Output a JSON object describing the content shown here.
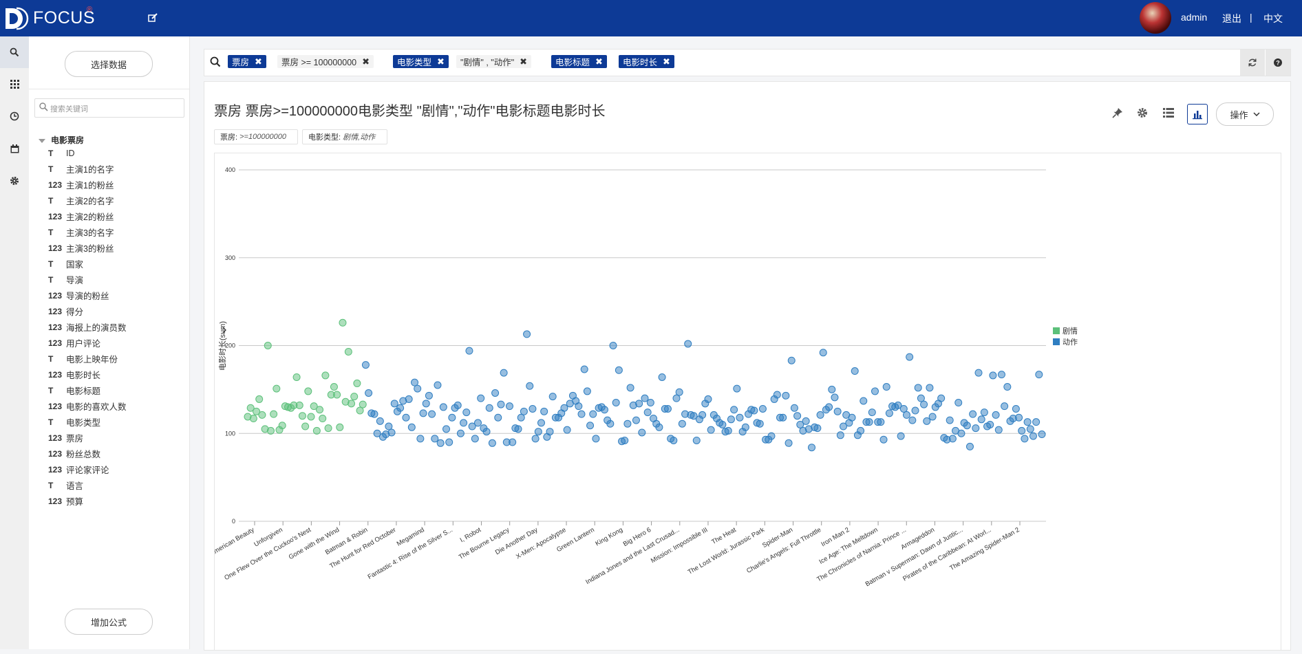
{
  "header": {
    "brand": "FOCUS",
    "brand_mark": "®",
    "user": "admin",
    "logout": "退出",
    "separator": "|",
    "language": "中文"
  },
  "rail": {
    "items": [
      "search-icon",
      "grid-icon",
      "history-icon",
      "calendar-icon",
      "settings-icon"
    ]
  },
  "sidebar": {
    "select_data": "选择数据",
    "search_placeholder": "搜索关键词",
    "root": "电影票房",
    "fields": [
      {
        "type": "T",
        "name": "ID"
      },
      {
        "type": "T",
        "name": "主演1的名字"
      },
      {
        "type": "123",
        "name": "主演1的粉丝"
      },
      {
        "type": "T",
        "name": "主演2的名字"
      },
      {
        "type": "123",
        "name": "主演2的粉丝"
      },
      {
        "type": "T",
        "name": "主演3的名字"
      },
      {
        "type": "123",
        "name": "主演3的粉丝"
      },
      {
        "type": "T",
        "name": "国家"
      },
      {
        "type": "T",
        "name": "导演"
      },
      {
        "type": "123",
        "name": "导演的粉丝"
      },
      {
        "type": "123",
        "name": "得分"
      },
      {
        "type": "123",
        "name": "海报上的演员数"
      },
      {
        "type": "123",
        "name": "用户评论"
      },
      {
        "type": "T",
        "name": "电影上映年份"
      },
      {
        "type": "123",
        "name": "电影时长"
      },
      {
        "type": "T",
        "name": "电影标题"
      },
      {
        "type": "123",
        "name": "电影的喜欢人数"
      },
      {
        "type": "T",
        "name": "电影类型"
      },
      {
        "type": "123",
        "name": "票房"
      },
      {
        "type": "123",
        "name": "粉丝总数"
      },
      {
        "type": "123",
        "name": "评论家评论"
      },
      {
        "type": "T",
        "name": "语言"
      },
      {
        "type": "123",
        "name": "预算"
      }
    ],
    "add_formula": "增加公式"
  },
  "search": {
    "chips": [
      {
        "label": "票房",
        "style": "blue"
      },
      {
        "label": "票房 >= 100000000",
        "style": "plain"
      },
      {
        "label": "电影类型",
        "style": "blue"
      },
      {
        "label": "\"剧情\" , \"动作\"",
        "style": "plain"
      },
      {
        "label": "电影标题",
        "style": "blue"
      },
      {
        "label": "电影时长",
        "style": "blue"
      }
    ],
    "remove": "✖"
  },
  "panel": {
    "title": "票房 票房>=100000000电影类型 \"剧情\",\"动作\"电影标题电影时长",
    "operations": "操作",
    "filters": [
      {
        "label": "票房:",
        "value": ">=100000000"
      },
      {
        "label": "电影类型:",
        "value": "剧情,动作"
      }
    ]
  },
  "chart_data": {
    "type": "scatter",
    "ylabel": "电影时长(sum)",
    "ylim": [
      0,
      400
    ],
    "yticks": [
      0,
      100,
      200,
      300,
      400
    ],
    "legend_position": "right",
    "grid": true,
    "xtick_labels": [
      "American Beauty",
      "Unforgiven",
      "One Flew Over the Cuckoo's Nest",
      "Gone with the Wind",
      "Batman & Robin",
      "The Hunt for Red October",
      "Megamind",
      "Fantastic 4: Rise of the Silver S...",
      "I, Robot",
      "The Bourne Legacy",
      "Die Another Day",
      "X-Men: Apocalypse",
      "Green Lantern",
      "King Kong",
      "Big Hero 6",
      "Indiana Jones and the Last Crusad...",
      "Mission: Impossible III",
      "The Heat",
      "The Lost World: Jurassic Park",
      "Spider-Man",
      "Charlie's Angels: Full Throttle",
      "Iron Man 2",
      "Ice Age: The Meltdown",
      "The Chronicles of Narnia: Prince ...",
      "Armageddon",
      "Batman v Superman: Dawn of Justic...",
      "Pirates of the Caribbean: At Worl...",
      "The Amazing Spider-Man 2"
    ],
    "series": [
      {
        "name": "剧情",
        "color": "#5cc07a",
        "values": [
          119,
          129,
          117,
          125,
          139,
          121,
          105,
          200,
          103,
          122,
          151,
          104,
          109,
          131,
          130,
          129,
          132,
          164,
          132,
          120,
          108,
          148,
          119,
          131,
          103,
          127,
          117,
          166,
          106,
          144,
          153,
          144,
          107,
          226,
          136,
          193,
          134,
          142,
          157,
          126,
          133
        ]
      },
      {
        "name": "动作",
        "color": "#2f7ec1",
        "values": [
          178,
          146,
          123,
          122,
          100,
          114,
          96,
          99,
          108,
          101,
          134,
          125,
          129,
          137,
          118,
          139,
          107,
          158,
          151,
          94,
          123,
          134,
          143,
          122,
          94,
          155,
          89,
          130,
          105,
          90,
          118,
          129,
          132,
          100,
          112,
          124,
          194,
          108,
          94,
          112,
          140,
          106,
          102,
          129,
          89,
          146,
          118,
          133,
          169,
          90,
          131,
          90,
          106,
          105,
          118,
          125,
          213,
          154,
          128,
          94,
          102,
          112,
          125,
          96,
          102,
          142,
          118,
          118,
          123,
          129,
          104,
          134,
          143,
          137,
          131,
          122,
          173,
          148,
          109,
          122,
          94,
          129,
          130,
          127,
          115,
          111,
          200,
          135,
          172,
          91,
          92,
          111,
          152,
          132,
          115,
          134,
          101,
          140,
          124,
          135,
          117,
          111,
          107,
          164,
          128,
          128,
          94,
          92,
          140,
          147,
          111,
          122,
          202,
          121,
          120,
          92,
          116,
          121,
          134,
          139,
          104,
          121,
          117,
          112,
          110,
          102,
          103,
          116,
          127,
          151,
          118,
          102,
          107,
          122,
          127,
          126,
          112,
          111,
          128,
          93,
          93,
          97,
          139,
          144,
          118,
          118,
          143,
          89,
          183,
          129,
          120,
          110,
          103,
          114,
          105,
          84,
          107,
          106,
          121,
          192,
          127,
          130,
          150,
          141,
          125,
          98,
          108,
          121,
          112,
          118,
          171,
          98,
          103,
          137,
          113,
          113,
          124,
          148,
          113,
          113,
          93,
          153,
          123,
          131,
          130,
          132,
          97,
          128,
          121,
          187,
          115,
          126,
          152,
          140,
          133,
          114,
          152,
          119,
          130,
          134,
          140,
          95,
          93,
          115,
          94,
          103,
          135,
          100,
          112,
          109,
          85,
          122,
          106,
          169,
          116,
          124,
          108,
          110,
          166,
          121,
          104,
          167,
          131,
          153,
          114,
          117,
          128,
          118,
          103,
          94,
          113,
          105,
          97,
          113,
          167,
          99
        ]
      }
    ]
  }
}
